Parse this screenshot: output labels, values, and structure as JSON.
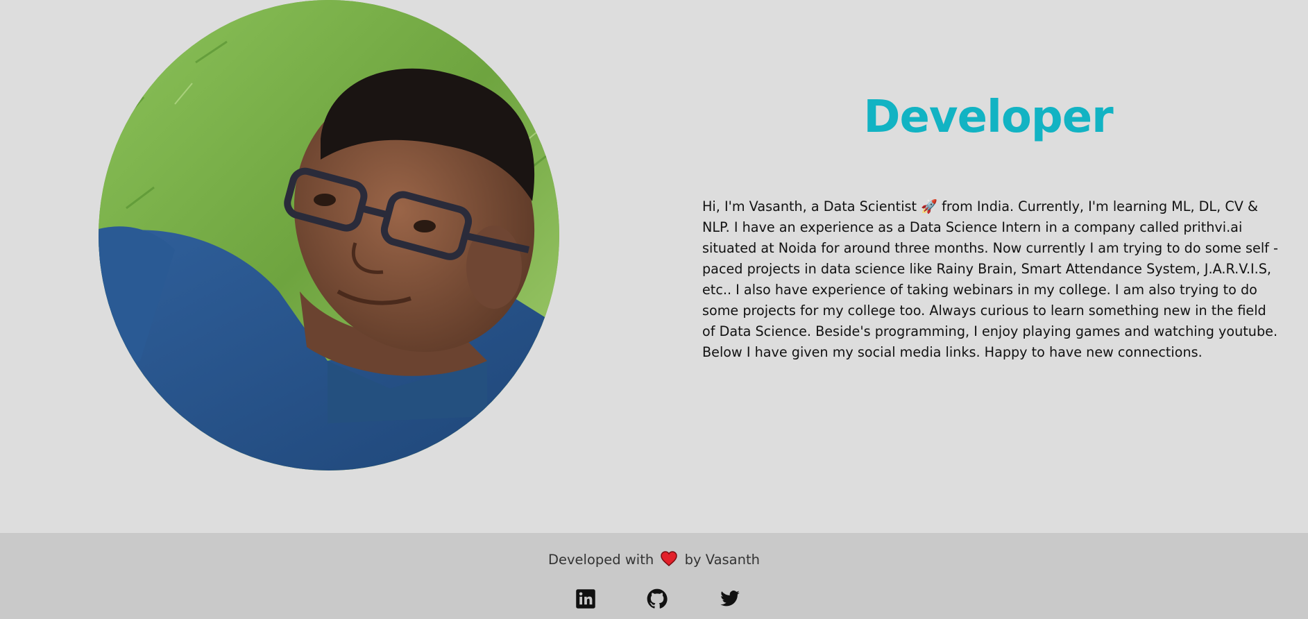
{
  "hero": {
    "title": "Developer",
    "bio": "Hi, I'm Vasanth, a Data Scientist 🚀 from India. Currently, I'm learning ML, DL, CV & NLP. I have an experience as a Data Science Intern in a company called prithvi.ai situated at Noida for around three months. Now currently I am trying to do some self - paced projects in data science like Rainy Brain, Smart Attendance System, J.A.R.V.I.S, etc.. I also have experience of taking webinars in my college. I am also trying to do some projects for my college too. Always curious to learn something new in the field of Data Science. Beside's programming, I enjoy playing games and watching youtube. Below I have given my social media links. Happy to have new connections.",
    "accent_color": "#12b3c3"
  },
  "footer": {
    "credit_prefix": "Developed with",
    "credit_suffix": "by Vasanth",
    "heart_icon": "heart-icon",
    "socials": [
      {
        "icon": "linkedin-icon"
      },
      {
        "icon": "github-icon"
      },
      {
        "icon": "twitter-icon"
      }
    ]
  }
}
